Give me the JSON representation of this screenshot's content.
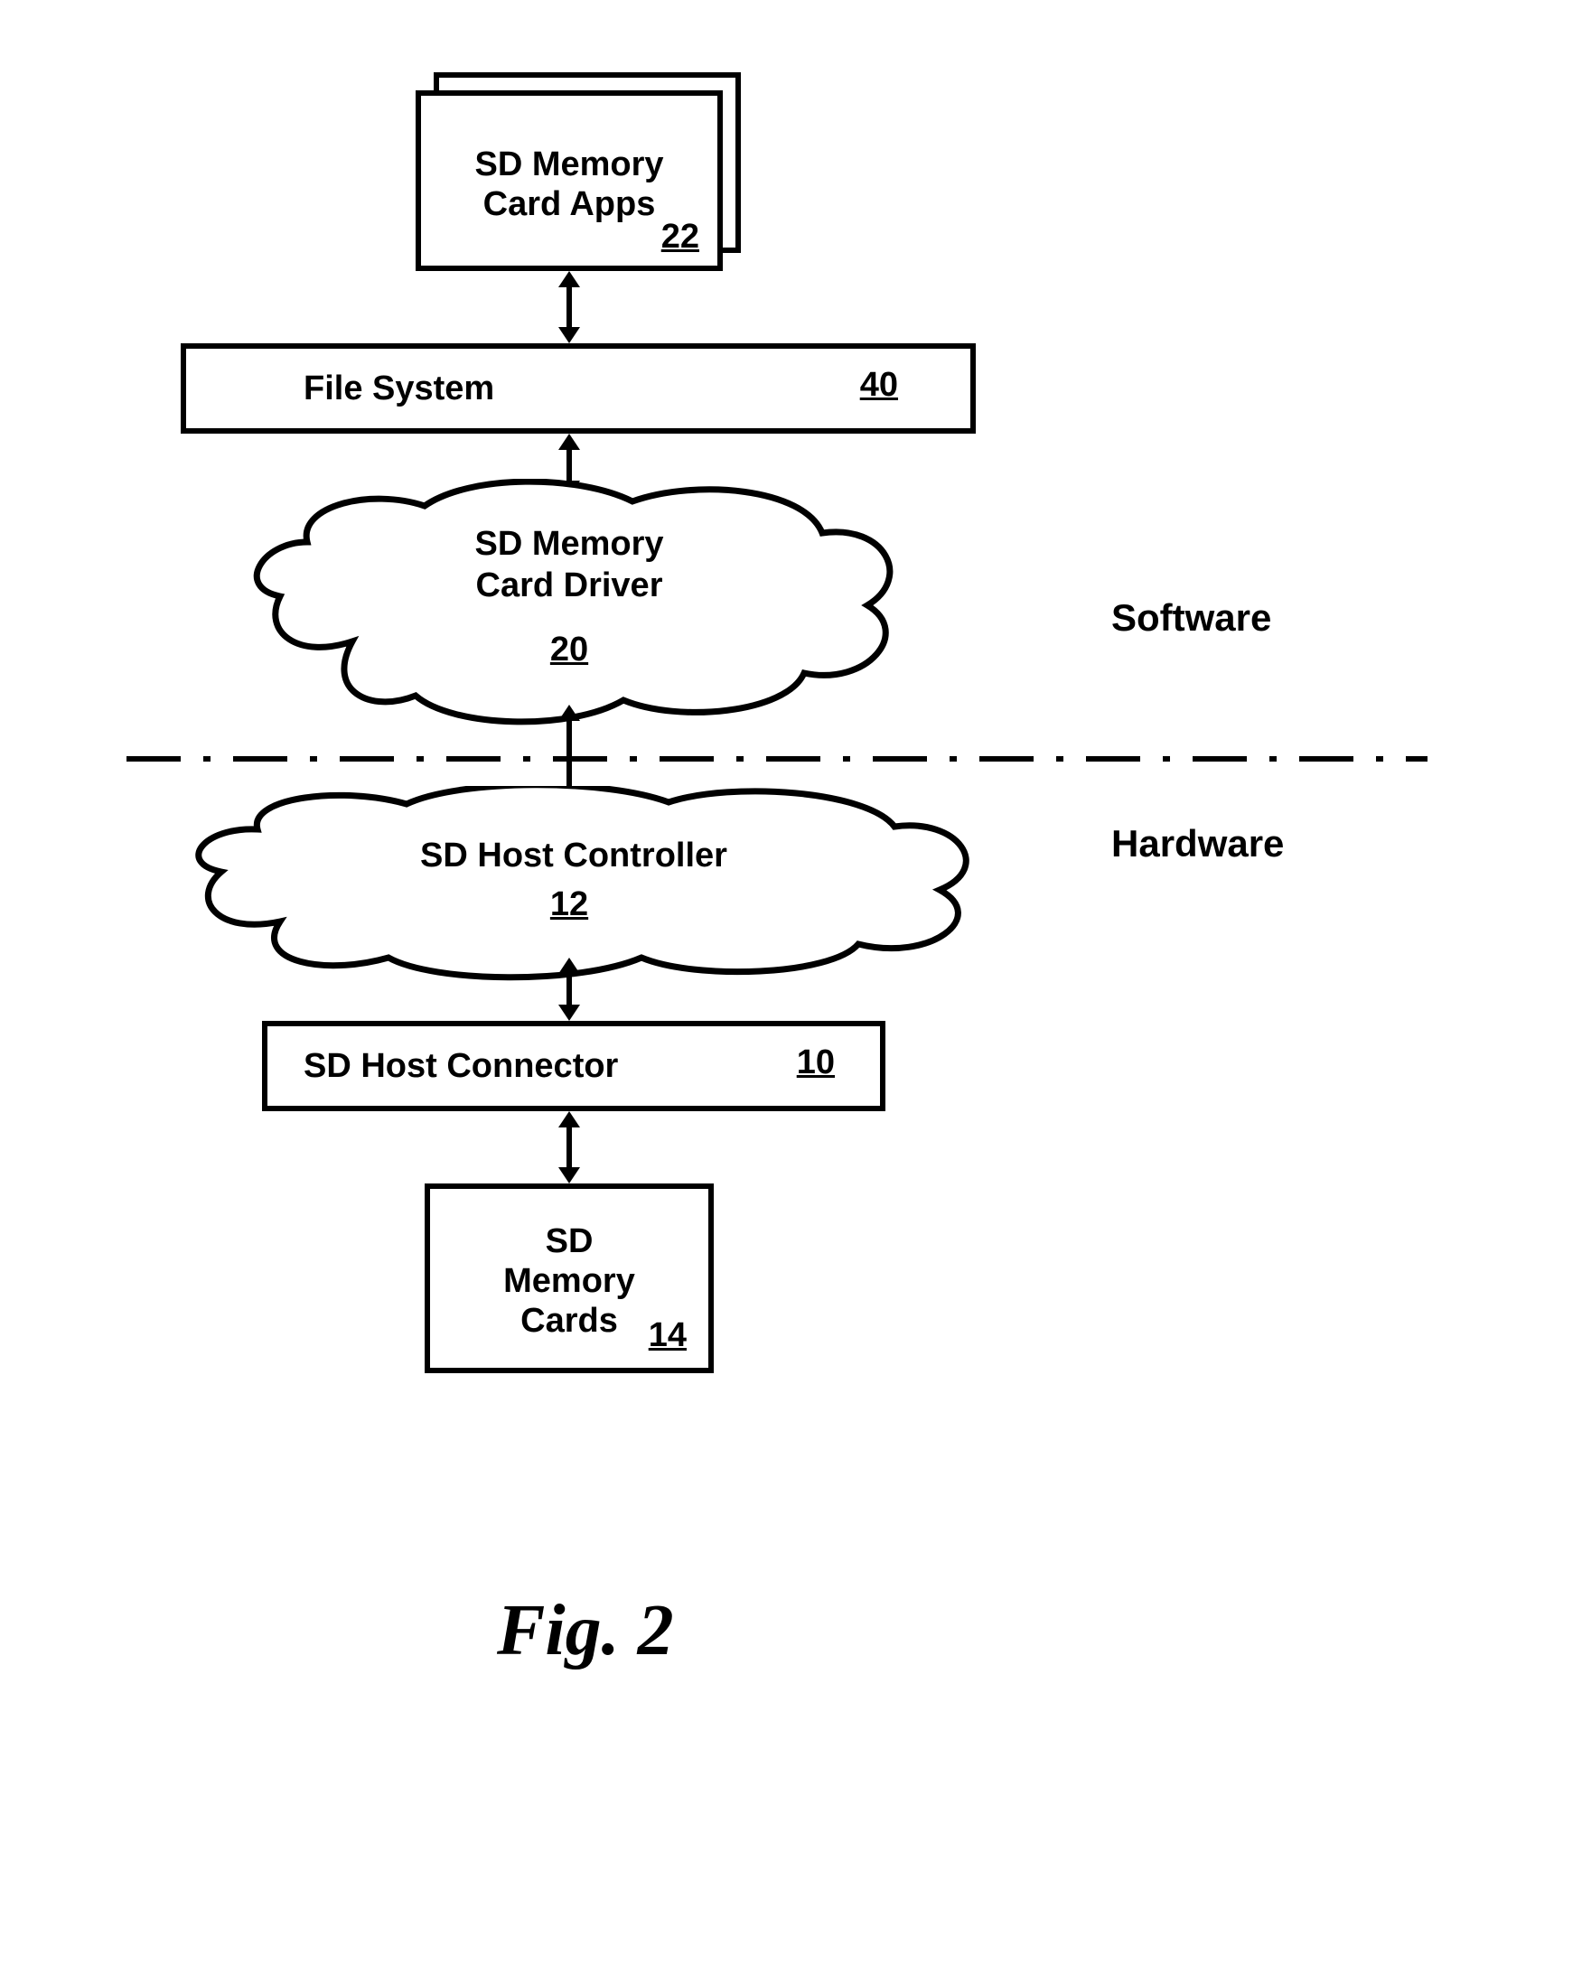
{
  "blocks": {
    "apps": {
      "label": "SD Memory\nCard Apps",
      "num": "22"
    },
    "filesystem": {
      "label": "File System",
      "num": "40"
    },
    "driver": {
      "label": "SD Memory\nCard Driver",
      "num": "20"
    },
    "controller": {
      "label": "SD Host Controller",
      "num": "12"
    },
    "connector": {
      "label": "SD Host Connector",
      "num": "10"
    },
    "cards": {
      "label": "SD\nMemory\nCards",
      "num": "14"
    }
  },
  "labels": {
    "software": "Software",
    "hardware": "Hardware"
  },
  "caption": "Fig. 2"
}
